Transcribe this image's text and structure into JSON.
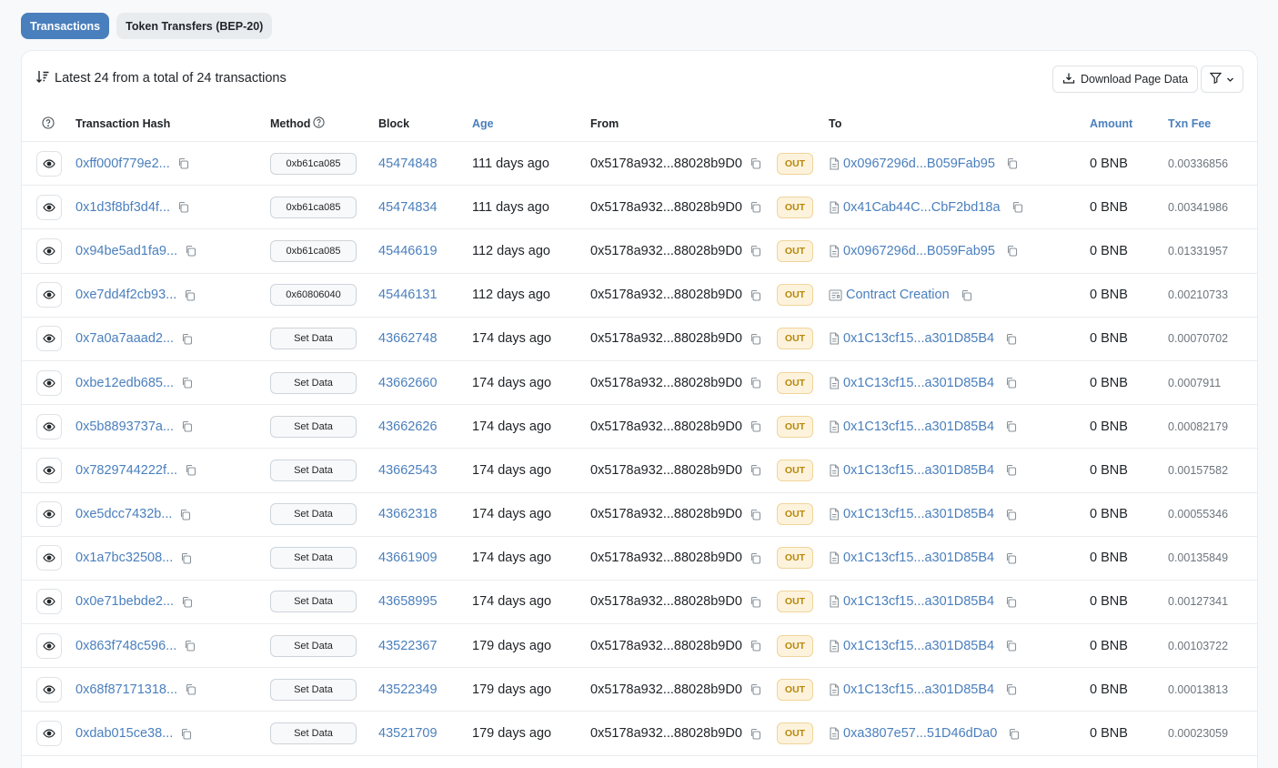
{
  "tabs": [
    {
      "label": "Transactions",
      "active": true
    },
    {
      "label": "Token Transfers (BEP-20)",
      "active": false
    }
  ],
  "summary": "Latest 24 from a total of 24 transactions",
  "download_label": "Download Page Data",
  "columns": {
    "info": "?",
    "hash": "Transaction Hash",
    "method": "Method",
    "block": "Block",
    "age": "Age",
    "from": "From",
    "to": "To",
    "amount": "Amount",
    "fee": "Txn Fee"
  },
  "colors": {
    "accent": "#4a7fbd",
    "out_bg": "#fdf3dc",
    "out_text": "#b8860b"
  },
  "rows": [
    {
      "hash": "0xff000f779e2...",
      "method": "0xb61ca085",
      "block": "45474848",
      "age": "111 days ago",
      "from": "0x5178a932...88028b9D0",
      "dir": "OUT",
      "to": "0x0967296d...B059Fab95",
      "to_icon": "doc",
      "amount": "0 BNB",
      "fee": "0.00336856"
    },
    {
      "hash": "0x1d3f8bf3d4f...",
      "method": "0xb61ca085",
      "block": "45474834",
      "age": "111 days ago",
      "from": "0x5178a932...88028b9D0",
      "dir": "OUT",
      "to": "0x41Cab44C...CbF2bd18a",
      "to_icon": "doc",
      "amount": "0 BNB",
      "fee": "0.00341986"
    },
    {
      "hash": "0x94be5ad1fa9...",
      "method": "0xb61ca085",
      "block": "45446619",
      "age": "112 days ago",
      "from": "0x5178a932...88028b9D0",
      "dir": "OUT",
      "to": "0x0967296d...B059Fab95",
      "to_icon": "doc",
      "amount": "0 BNB",
      "fee": "0.01331957"
    },
    {
      "hash": "0xe7dd4f2cb93...",
      "method": "0x60806040",
      "block": "45446131",
      "age": "112 days ago",
      "from": "0x5178a932...88028b9D0",
      "dir": "OUT",
      "to": "Contract Creation",
      "to_icon": "contract",
      "amount": "0 BNB",
      "fee": "0.00210733"
    },
    {
      "hash": "0x7a0a7aaad2...",
      "method": "Set Data",
      "block": "43662748",
      "age": "174 days ago",
      "from": "0x5178a932...88028b9D0",
      "dir": "OUT",
      "to": "0x1C13cf15...a301D85B4",
      "to_icon": "doc",
      "amount": "0 BNB",
      "fee": "0.00070702"
    },
    {
      "hash": "0xbe12edb685...",
      "method": "Set Data",
      "block": "43662660",
      "age": "174 days ago",
      "from": "0x5178a932...88028b9D0",
      "dir": "OUT",
      "to": "0x1C13cf15...a301D85B4",
      "to_icon": "doc",
      "amount": "0 BNB",
      "fee": "0.0007911"
    },
    {
      "hash": "0x5b8893737a...",
      "method": "Set Data",
      "block": "43662626",
      "age": "174 days ago",
      "from": "0x5178a932...88028b9D0",
      "dir": "OUT",
      "to": "0x1C13cf15...a301D85B4",
      "to_icon": "doc",
      "amount": "0 BNB",
      "fee": "0.00082179"
    },
    {
      "hash": "0x7829744222f...",
      "method": "Set Data",
      "block": "43662543",
      "age": "174 days ago",
      "from": "0x5178a932...88028b9D0",
      "dir": "OUT",
      "to": "0x1C13cf15...a301D85B4",
      "to_icon": "doc",
      "amount": "0 BNB",
      "fee": "0.00157582"
    },
    {
      "hash": "0xe5dcc7432b...",
      "method": "Set Data",
      "block": "43662318",
      "age": "174 days ago",
      "from": "0x5178a932...88028b9D0",
      "dir": "OUT",
      "to": "0x1C13cf15...a301D85B4",
      "to_icon": "doc",
      "amount": "0 BNB",
      "fee": "0.00055346"
    },
    {
      "hash": "0x1a7bc32508...",
      "method": "Set Data",
      "block": "43661909",
      "age": "174 days ago",
      "from": "0x5178a932...88028b9D0",
      "dir": "OUT",
      "to": "0x1C13cf15...a301D85B4",
      "to_icon": "doc",
      "amount": "0 BNB",
      "fee": "0.00135849"
    },
    {
      "hash": "0x0e71bebde2...",
      "method": "Set Data",
      "block": "43658995",
      "age": "174 days ago",
      "from": "0x5178a932...88028b9D0",
      "dir": "OUT",
      "to": "0x1C13cf15...a301D85B4",
      "to_icon": "doc",
      "amount": "0 BNB",
      "fee": "0.00127341"
    },
    {
      "hash": "0x863f748c596...",
      "method": "Set Data",
      "block": "43522367",
      "age": "179 days ago",
      "from": "0x5178a932...88028b9D0",
      "dir": "OUT",
      "to": "0x1C13cf15...a301D85B4",
      "to_icon": "doc",
      "amount": "0 BNB",
      "fee": "0.00103722"
    },
    {
      "hash": "0x68f87171318...",
      "method": "Set Data",
      "block": "43522349",
      "age": "179 days ago",
      "from": "0x5178a932...88028b9D0",
      "dir": "OUT",
      "to": "0x1C13cf15...a301D85B4",
      "to_icon": "doc",
      "amount": "0 BNB",
      "fee": "0.00013813"
    },
    {
      "hash": "0xdab015ce38...",
      "method": "Set Data",
      "block": "43521709",
      "age": "179 days ago",
      "from": "0x5178a932...88028b9D0",
      "dir": "OUT",
      "to": "0xa3807e57...51D46dDa0",
      "to_icon": "doc",
      "amount": "0 BNB",
      "fee": "0.00023059"
    }
  ]
}
